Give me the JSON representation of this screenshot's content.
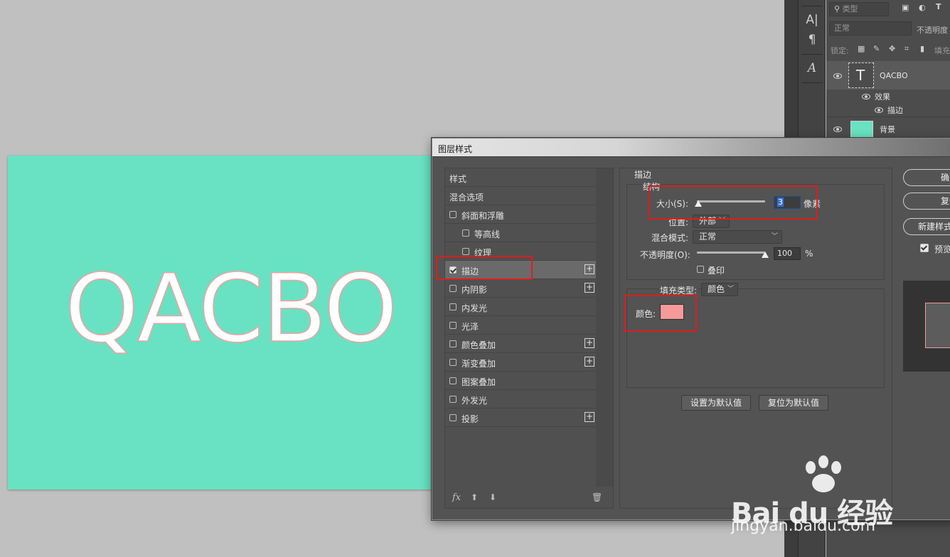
{
  "canvas": {
    "text": "QACBO",
    "background": "#68e2c2",
    "text_color": "#ffffff",
    "stroke_color": "#f4a0a0"
  },
  "tools": {
    "icons": [
      "char-panel-icon",
      "paragraph-icon",
      "glyph-icon"
    ]
  },
  "layers_panel": {
    "filter_placeholder": "类型",
    "blend_mode": "正常",
    "opacity_label": "不透明度",
    "lock_label": "锁定:",
    "fill_label": "填充",
    "layers": [
      {
        "name": "QACBO",
        "kind": "text"
      },
      {
        "name": "背景",
        "kind": "fill",
        "color": "#68e2c2"
      }
    ],
    "effects_label": "效果",
    "effect_stroke": "描边"
  },
  "dialog": {
    "title": "图层样式",
    "styles": [
      {
        "label": "样式"
      },
      {
        "label": "混合选项"
      },
      {
        "label": "斜面和浮雕",
        "check": false
      },
      {
        "label": "等高线",
        "check": false
      },
      {
        "label": "纹理",
        "check": false
      },
      {
        "label": "描边",
        "check": true,
        "plus": true
      },
      {
        "label": "内阴影",
        "check": false,
        "plus": true
      },
      {
        "label": "内发光",
        "check": false
      },
      {
        "label": "光泽",
        "check": false
      },
      {
        "label": "颜色叠加",
        "check": false,
        "plus": true
      },
      {
        "label": "渐变叠加",
        "check": false,
        "plus": true
      },
      {
        "label": "图案叠加",
        "check": false
      },
      {
        "label": "外发光",
        "check": false
      },
      {
        "label": "投影",
        "check": false,
        "plus": true
      }
    ],
    "footer": {
      "fx": "fx"
    },
    "stroke": {
      "section_title": "描边",
      "structure_title": "结构",
      "size_label": "大小(S):",
      "size_value": "3",
      "size_unit": "像素",
      "size_fraction": 0.02,
      "position_label": "位置:",
      "position_value": "外部",
      "blend_label": "混合模式:",
      "blend_value": "正常",
      "opacity_label": "不透明度(O):",
      "opacity_value": "100",
      "opacity_unit": "%",
      "opacity_fraction": 1.0,
      "overprint_label": "叠印",
      "fill_type_label": "填充类型:",
      "fill_type_value": "颜色",
      "color_label": "颜色:",
      "color_value": "#f49a9a",
      "set_default": "设置为默认值",
      "reset_default": "复位为默认值"
    },
    "buttons": {
      "ok": "确定",
      "reset": "复位",
      "new_style": "新建样式...",
      "preview": "预览"
    }
  },
  "watermark": {
    "brand": "Bai du 经验",
    "url": "jingyan.baidu.com"
  }
}
